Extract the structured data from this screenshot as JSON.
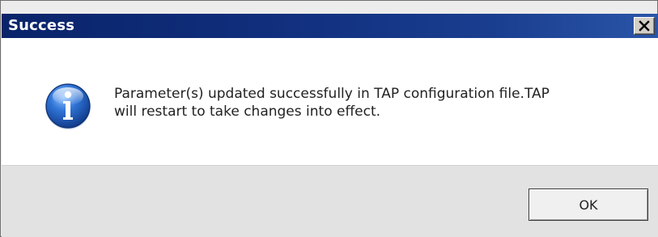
{
  "dialog": {
    "title": "Success",
    "close_icon": "close-icon",
    "message_icon": "info-icon",
    "message_line1": "Parameter(s) updated successfully in TAP configuration file.TAP",
    "message_line2": "will restart to take changes into effect.",
    "ok_label": "OK"
  },
  "colors": {
    "titlebar": "#0a246a",
    "content_bg": "#ffffff",
    "footer_bg": "#e2e2e2",
    "info_icon_blue": "#1f5fbf"
  }
}
